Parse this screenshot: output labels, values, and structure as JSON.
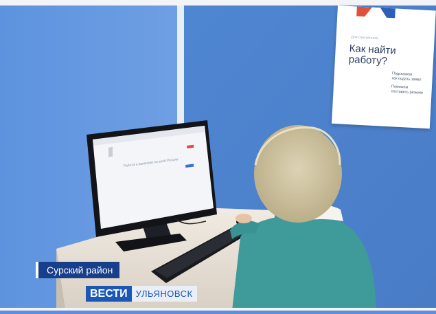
{
  "poster": {
    "small_text": "Для соискателей",
    "title": "Как найти\nработу?",
    "items": [
      "Подскажем\nкак подать заявл",
      "Поможем\nсоставить резюме"
    ]
  },
  "monitor": {
    "headline": "Работа и вакансии по всей России"
  },
  "caption": {
    "region": "Сурский район",
    "brand_a": "ВЕСТИ",
    "brand_b": "УЛЬЯНОВСК"
  }
}
